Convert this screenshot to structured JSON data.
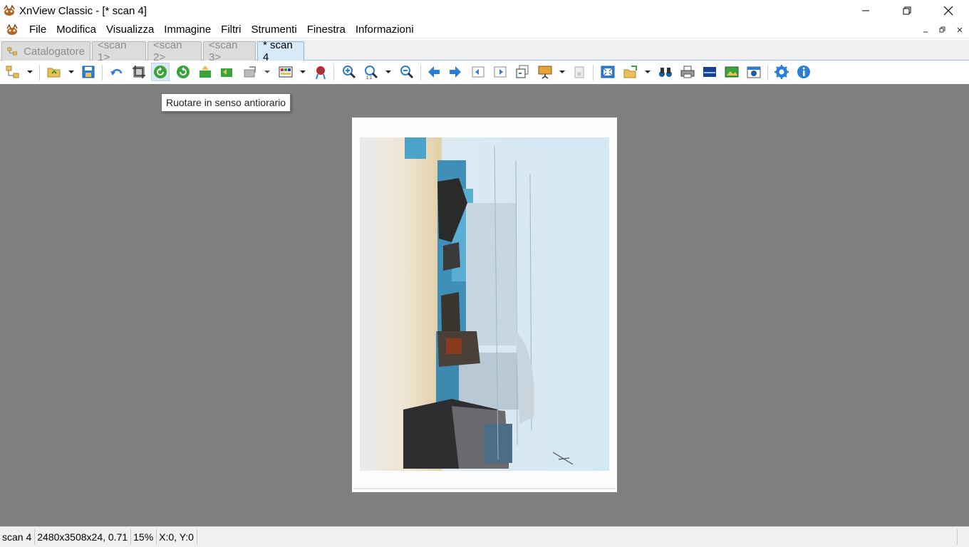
{
  "window": {
    "title": "XnView Classic - [* scan 4]"
  },
  "menu": {
    "items": [
      "File",
      "Modifica",
      "Visualizza",
      "Immagine",
      "Filtri",
      "Strumenti",
      "Finestra",
      "Informazioni"
    ]
  },
  "tabs": [
    {
      "label": "Catalogatore",
      "active": false
    },
    {
      "label": "<scan 1>",
      "active": false
    },
    {
      "label": "<scan 2>",
      "active": false
    },
    {
      "label": "<scan 3>",
      "active": false
    },
    {
      "label": "* scan 4",
      "active": true
    }
  ],
  "toolbar": {
    "tooltip": "Ruotare in senso antiorario"
  },
  "status": {
    "filename": "scan 4",
    "info": "2480x3508x24, 0.71",
    "zoom": "15%",
    "coords": "X:0, Y:0"
  },
  "colors": {
    "viewer_bg": "#808080",
    "active_tab": "#d8e9f7",
    "toolbar_blue": "#2a7fd4"
  }
}
